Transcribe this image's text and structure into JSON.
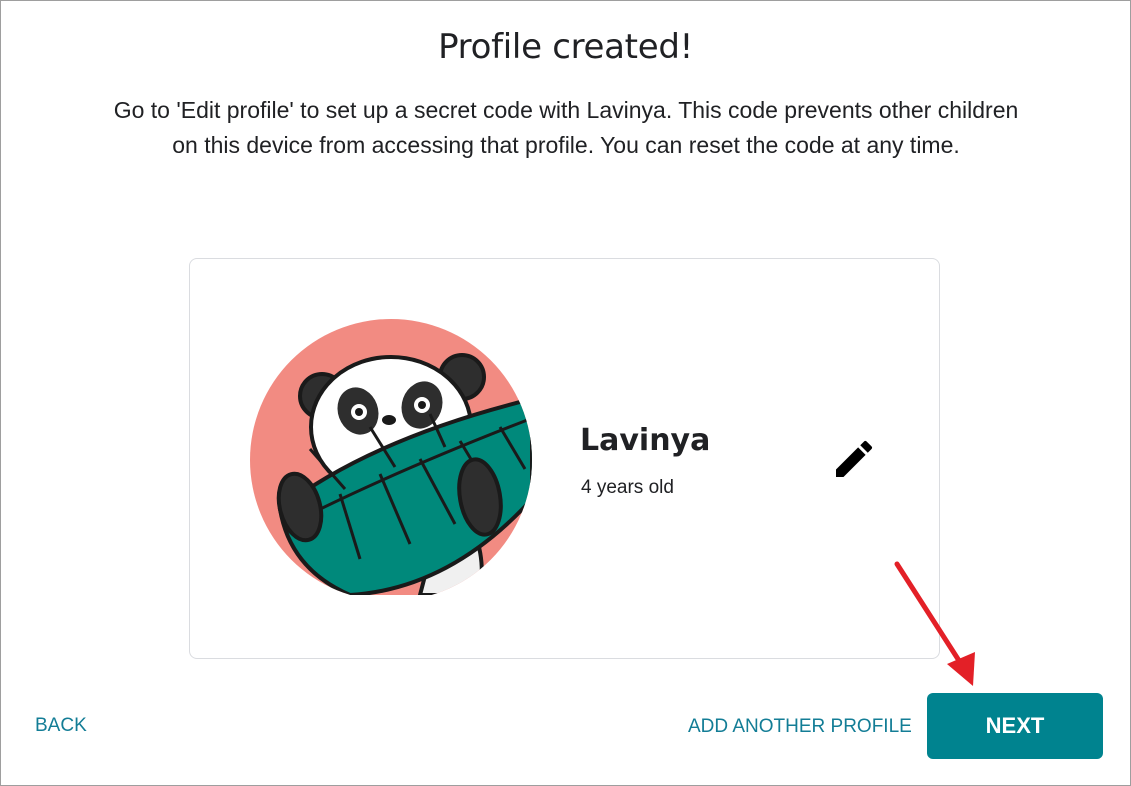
{
  "title": "Profile created!",
  "description": "Go to 'Edit profile' to set up a secret code with Lavinya. This code prevents other children on this device from accessing that profile. You can reset the code at any time.",
  "profile": {
    "name": "Lavinya",
    "age": "4 years old",
    "avatar_icon": "panda-avatar"
  },
  "actions": {
    "back": "BACK",
    "add_another": "ADD ANOTHER PROFILE",
    "next": "NEXT"
  },
  "colors": {
    "accent": "#00838f",
    "link": "#137d96",
    "avatar_bg": "#f28b82",
    "leaf": "#00897b",
    "annotation_arrow": "#e32027"
  }
}
